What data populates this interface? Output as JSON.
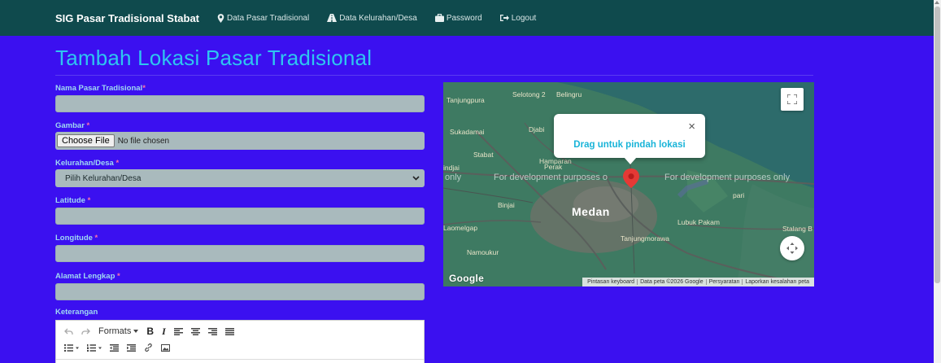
{
  "navbar": {
    "brand": "SIG Pasar Tradisional Stabat",
    "items": [
      {
        "label": "Data Pasar Tradisional",
        "icon": "map-marker-icon"
      },
      {
        "label": "Data Kelurahan/Desa",
        "icon": "road-icon"
      },
      {
        "label": "Password",
        "icon": "briefcase-icon"
      },
      {
        "label": "Logout",
        "icon": "logout-icon"
      }
    ]
  },
  "page": {
    "title": "Tambah Lokasi Pasar Tradisional"
  },
  "form": {
    "nama_label": "Nama Pasar Tradisional",
    "gambar_label": "Gambar",
    "file_button": "Choose File",
    "file_status": "No file chosen",
    "kelurahan_label": "Kelurahan/Desa",
    "kelurahan_selected": "Pilih Kelurahan/Desa",
    "latitude_label": "Latitude",
    "longitude_label": "Longitude",
    "alamat_label": "Alamat Lengkap",
    "keterangan_label": "Keterangan",
    "required_mark": "*"
  },
  "editor": {
    "formats_label": "Formats",
    "bold_label": "B",
    "italic_label": "I"
  },
  "map": {
    "places": {
      "selotong": "Selotong 2",
      "belingru": "Belingru",
      "tanjungpura": "Tanjungpura",
      "sukadamai": "Sukadamai",
      "djabi": "Djabi",
      "stabat": "Stabat",
      "hamparan": "Hamparan",
      "perak": "Perak",
      "indjai": "indjai",
      "binjai": "Binjai",
      "medan": "Medan",
      "pari": "pari",
      "lubukpakam": "Lubuk Pakam",
      "stalang": "Stalang B",
      "laomelgap": "Laomelgap",
      "tanjungmorawa": "Tanjungmorawa",
      "namoukur": "Namoukur"
    },
    "watermark_left": "only",
    "watermark_mid": "For development purposes o",
    "watermark_right": "For development purposes only",
    "popup_text": "Drag untuk pindah lokasi",
    "popup_close": "×",
    "google": "Google",
    "attribution": [
      "Pintasan keyboard",
      "Data peta ©2026 Google",
      "Persyaratan",
      "Laporkan kesalahan peta"
    ]
  },
  "colors": {
    "navbar": "#0f4a4d",
    "background": "#3b10f0",
    "title": "#2ec6f0",
    "marker": "#e53935"
  }
}
